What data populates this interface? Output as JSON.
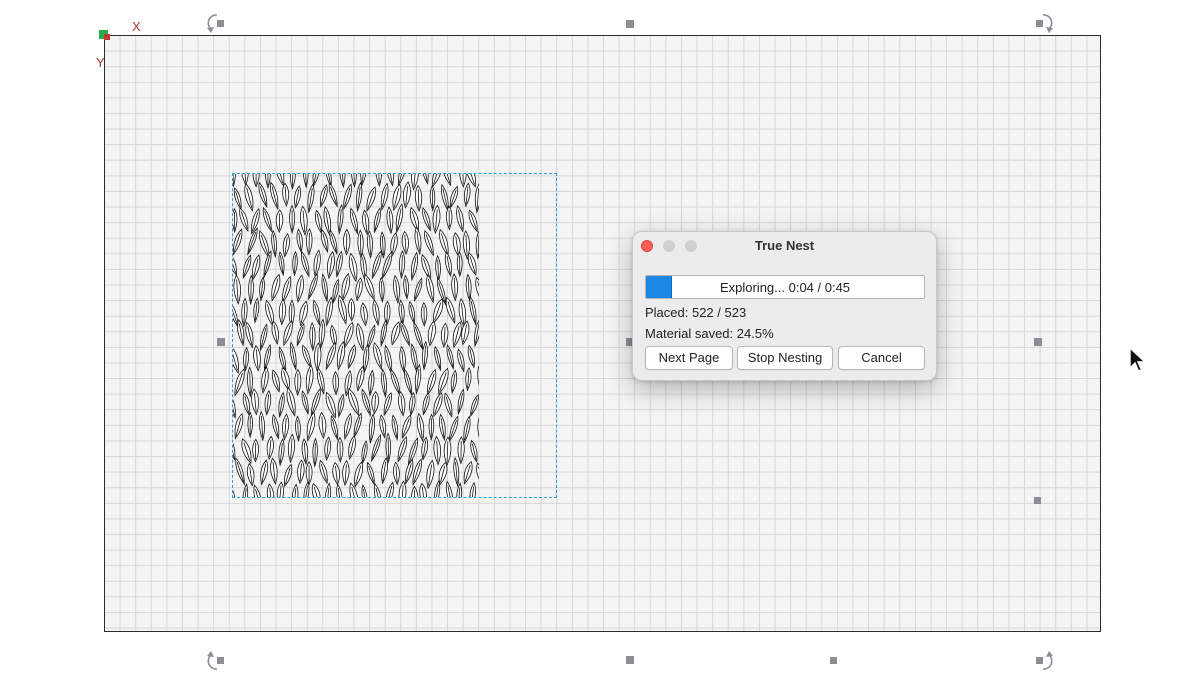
{
  "canvas": {
    "axis_x_label": "X",
    "axis_y_label": "Y"
  },
  "dialog": {
    "title": "True Nest",
    "progress": {
      "status_text": "Exploring...  0:04 / 0:45",
      "fraction": 0.089
    },
    "placed_text": "Placed: 522 / 523",
    "material_saved_text": "Material saved: 24.5%",
    "buttons": {
      "next_page": "Next Page",
      "stop_nesting": "Stop Nesting",
      "cancel": "Cancel"
    }
  },
  "colors": {
    "selection_border": "#2a9fd8",
    "progress_fill": "#1d87e5",
    "close_button": "#fe5f57",
    "handle": "#8d8d96"
  },
  "icons": [
    "rotate-icon",
    "origin-marker-icon",
    "mouse-pointer-icon"
  ]
}
